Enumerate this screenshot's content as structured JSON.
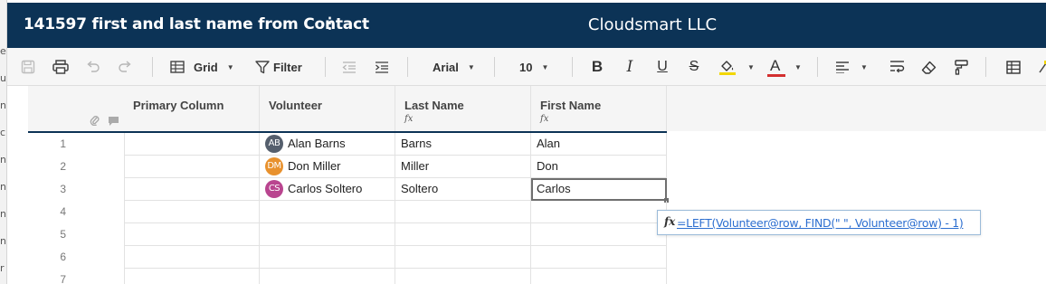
{
  "background_window": {
    "edge_glyphs": [
      "er",
      "u",
      "nt",
      "c",
      "n",
      "n",
      "n",
      "n",
      "r"
    ]
  },
  "header": {
    "sheet_title": "141597 first and last name from Contact",
    "more_icon": "⋮",
    "workspace": "Cloudsmart LLC",
    "background_color": "#0c3356"
  },
  "toolbar": {
    "view_label": "Grid",
    "filter_label": "Filter",
    "font_family": "Arial",
    "font_size": "10",
    "bold_label": "B",
    "italic_label": "I",
    "underline_label": "U",
    "strike_label": "S",
    "text_color_label": "A",
    "highlight_color": "#f2d600",
    "text_color": "#d32f2f",
    "icons": [
      "save-icon",
      "print-icon",
      "undo-icon",
      "redo-icon",
      "grid-icon",
      "filter-icon",
      "outdent-icon",
      "indent-icon",
      "fill-color-icon",
      "align-left-icon",
      "wrap-text-icon",
      "eraser-icon",
      "format-painter-icon",
      "table-icon"
    ]
  },
  "grid": {
    "header_icons": [
      "attachment-icon",
      "comment-icon"
    ],
    "columns": [
      {
        "label": "Primary Column",
        "formula_icon": ""
      },
      {
        "label": "Volunteer",
        "formula_icon": ""
      },
      {
        "label": "Last Name",
        "formula_icon": "fx"
      },
      {
        "label": "First Name",
        "formula_icon": "fx"
      }
    ],
    "rows": [
      {
        "num": "1",
        "primary": "",
        "volunteer": {
          "initials": "AB",
          "name": "Alan Barns",
          "color": "#555f6d"
        },
        "last": "Barns",
        "first": "Alan"
      },
      {
        "num": "2",
        "primary": "",
        "volunteer": {
          "initials": "DM",
          "name": "Don Miller",
          "color": "#e8912d"
        },
        "last": "Miller",
        "first": "Don"
      },
      {
        "num": "3",
        "primary": "",
        "volunteer": {
          "initials": "CS",
          "name": "Carlos Soltero",
          "color": "#b9458f"
        },
        "last": "Soltero",
        "first": "Carlos"
      },
      {
        "num": "4",
        "primary": "",
        "volunteer": null,
        "last": "",
        "first": ""
      },
      {
        "num": "5",
        "primary": "",
        "volunteer": null,
        "last": "",
        "first": ""
      },
      {
        "num": "6",
        "primary": "",
        "volunteer": null,
        "last": "",
        "first": ""
      },
      {
        "num": "7",
        "primary": "",
        "volunteer": null,
        "last": "",
        "first": ""
      }
    ],
    "selected_cell": {
      "row": "3",
      "column": "First Name"
    }
  },
  "formula_popup": {
    "icon_label": "fx",
    "formula": "=LEFT(Volunteer@row, FIND(\" \", Volunteer@row) - 1)"
  }
}
